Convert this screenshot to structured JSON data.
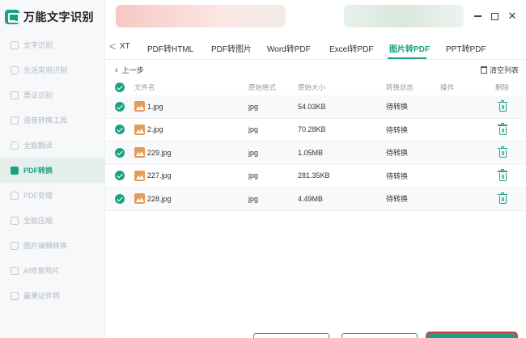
{
  "app": {
    "name": "万能文字识别"
  },
  "sidebar": {
    "items": [
      {
        "label": "文字识别",
        "active": false
      },
      {
        "label": "生活常用识别",
        "active": false
      },
      {
        "label": "票证识别",
        "active": false
      },
      {
        "label": "语音转换工具",
        "active": false
      },
      {
        "label": "全能翻译",
        "active": false
      },
      {
        "label": "PDF转换",
        "active": true
      },
      {
        "label": "PDF处理",
        "active": false
      },
      {
        "label": "全能压缩",
        "active": false
      },
      {
        "label": "图片编辑转换",
        "active": false
      },
      {
        "label": "AI修复照片",
        "active": false
      },
      {
        "label": "最美证件照",
        "active": false
      }
    ]
  },
  "window": {
    "min": "—",
    "max": "☐",
    "close": "✕"
  },
  "tabs": {
    "back_glyph": "<",
    "items": [
      "XT",
      "PDF转HTML",
      "PDF转图片",
      "Word转PDF",
      "Excel转PDF",
      "图片转PDF",
      "PPT转PDF"
    ],
    "active_index": 5
  },
  "toolbar": {
    "back_label": "上一步",
    "clear_label": "清空列表"
  },
  "table": {
    "headers": {
      "name": "文件名",
      "format": "原始格式",
      "size": "原始大小",
      "status": "转换状态",
      "operation": "操作",
      "delete": "删除"
    },
    "rows": [
      {
        "name": "1.jpg",
        "format": "jpg",
        "size": "54.03KB",
        "status": "待转换"
      },
      {
        "name": "2.jpg",
        "format": "jpg",
        "size": "70.28KB",
        "status": "待转换"
      },
      {
        "name": "229.jpg",
        "format": "jpg",
        "size": "1.05MB",
        "status": "待转换"
      },
      {
        "name": "227.jpg",
        "format": "jpg",
        "size": "281.35KB",
        "status": "待转换"
      },
      {
        "name": "228.jpg",
        "format": "jpg",
        "size": "4.49MB",
        "status": "待转换"
      }
    ]
  },
  "colors": {
    "accent": "#1aa184",
    "highlight": "#e23a3a",
    "file_icon": "#e69a57"
  }
}
